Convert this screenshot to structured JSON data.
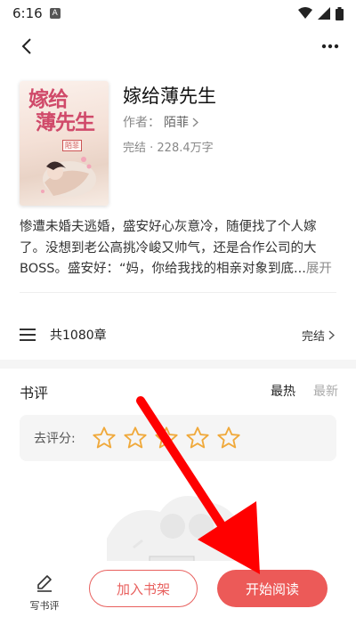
{
  "status_bar": {
    "time": "6:16",
    "notification_badge": "A"
  },
  "book": {
    "title": "嫁给薄先生",
    "author_label": "作者：",
    "author_name": "陌菲",
    "meta": "完结 · 228.4万字",
    "cover": {
      "title_line1": "嫁给",
      "title_line2": "薄先生",
      "author_badge": "陌菲"
    },
    "description": "惨遭未婚夫逃婚，盛安好心灰意冷，随便找了个人嫁了。没想到老公高挑冷峻又帅气，还是合作公司的大BOSS。盛安好：“妈，你给我找的相亲对象到底...",
    "description_more": "展开"
  },
  "chapters": {
    "count_label": "共1080章",
    "status_label": "完结"
  },
  "reviews": {
    "title": "书评",
    "tabs": [
      "最热",
      "最新"
    ],
    "rate_label": "去评分:",
    "star_count": 5,
    "star_color": "#f0a93b"
  },
  "bottom": {
    "write_review_label": "写书评",
    "add_shelf_label": "加入书架",
    "start_reading_label": "开始阅读"
  },
  "colors": {
    "accent": "#ec5a58",
    "annotation_arrow": "#ff0000"
  }
}
